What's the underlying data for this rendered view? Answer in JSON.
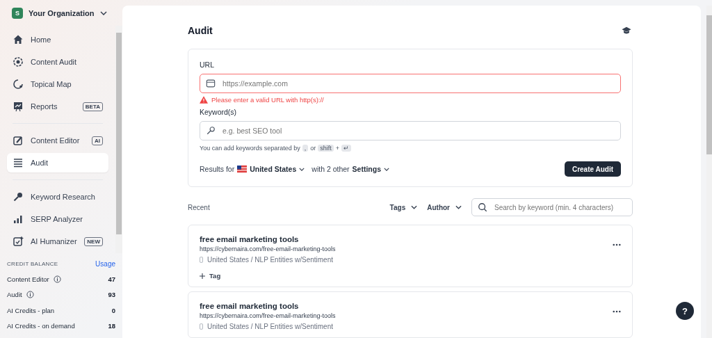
{
  "org": {
    "initial": "S",
    "name": "Your Organization"
  },
  "nav_groups": [
    [
      {
        "label": "Home",
        "selected": false
      },
      {
        "label": "Content Audit",
        "selected": false
      },
      {
        "label": "Topical Map",
        "selected": false
      },
      {
        "label": "Reports",
        "badge": "BETA",
        "selected": false
      }
    ],
    [
      {
        "label": "Content Editor",
        "badge": "AI",
        "selected": false
      },
      {
        "label": "Audit",
        "selected": true
      }
    ],
    [
      {
        "label": "Keyword Research",
        "selected": false
      },
      {
        "label": "SERP Analyzer",
        "selected": false
      },
      {
        "label": "AI Humanizer",
        "badge": "NEW",
        "selected": false
      }
    ]
  ],
  "credits": {
    "title": "CREDIT BALANCE",
    "link": "Usage",
    "rows": [
      {
        "label": "Content Editor",
        "info": true,
        "value": "47"
      },
      {
        "label": "Audit",
        "info": true,
        "value": "93"
      },
      {
        "label": "AI Credits - plan",
        "info": false,
        "value": "0"
      },
      {
        "label": "AI Credits - on demand",
        "info": false,
        "value": "18"
      }
    ]
  },
  "page_title": "Audit",
  "form": {
    "url_label": "URL",
    "url_placeholder": "https://example.com",
    "url_error": "Please enter a valid URL with http(s)://",
    "keyword_label": "Keyword(s)",
    "keyword_placeholder": "e.g. best SEO tool",
    "hint": [
      "You can add keywords separated by",
      ",",
      "or",
      "shift",
      "+",
      "↵"
    ],
    "results_for": "Results for",
    "country": "United States",
    "with_other": "with 2 other",
    "settings": "Settings",
    "submit": "Create Audit"
  },
  "recent": {
    "title": "Recent",
    "filters": [
      "Tags",
      "Author"
    ],
    "search_placeholder": "Search by keyword (min. 4 characters)",
    "items": [
      {
        "title": "free email marketing tools",
        "url": "https://cybernaira.com/free-email-marketing-tools",
        "meta": "United States / NLP Entities w/Sentiment",
        "tag_button": "Tag"
      },
      {
        "title": "free email marketing tools",
        "url": "https://cybernaira.com/free-email-marketing-tools",
        "meta": "United States / NLP Entities w/Sentiment"
      }
    ]
  },
  "help": "?"
}
